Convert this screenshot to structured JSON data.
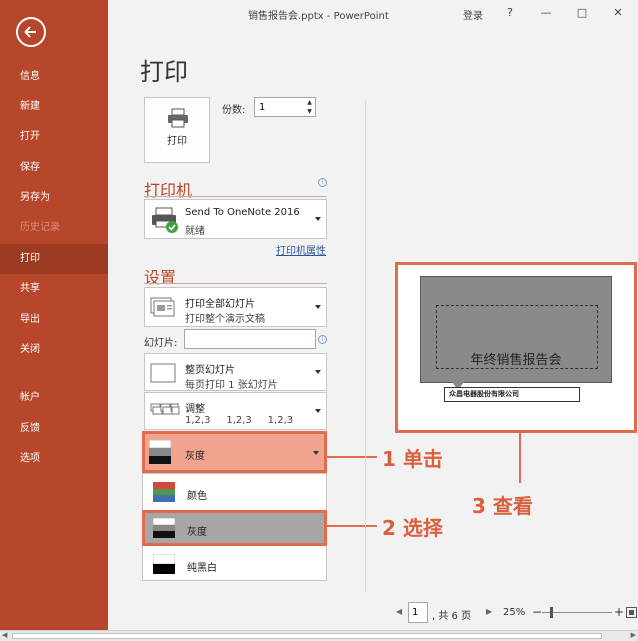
{
  "titlebar": {
    "title": "销售报告会.pptx - PowerPoint",
    "login": "登录",
    "help": "?",
    "minimize": "—",
    "maximize": "□",
    "close": "✕"
  },
  "sidebar": {
    "items": [
      {
        "label": "信息"
      },
      {
        "label": "新建"
      },
      {
        "label": "打开"
      },
      {
        "label": "保存"
      },
      {
        "label": "另存为"
      },
      {
        "label": "历史记录"
      },
      {
        "label": "打印"
      },
      {
        "label": "共享"
      },
      {
        "label": "导出"
      },
      {
        "label": "关闭"
      },
      {
        "label": "帐户"
      },
      {
        "label": "反馈"
      },
      {
        "label": "选项"
      }
    ]
  },
  "print": {
    "heading": "打印",
    "button_label": "打印",
    "copies_label": "份数:",
    "copies_value": "1"
  },
  "printer": {
    "section_title": "打印机",
    "name": "Send To OneNote 2016",
    "status": "就绪",
    "properties_link": "打印机属性"
  },
  "settings": {
    "section_title": "设置",
    "range": {
      "main": "打印全部幻灯片",
      "sub": "打印整个演示文稿"
    },
    "slides_label": "幻灯片:",
    "slides_value": "",
    "layout": {
      "main": "整页幻灯片",
      "sub": "每页打印 1 张幻灯片"
    },
    "collate": {
      "main": "调整",
      "sub": "1,2,3     1,2,3     1,2,3"
    },
    "color": {
      "main": "灰度"
    },
    "color_options": [
      {
        "label": "颜色"
      },
      {
        "label": "灰度"
      },
      {
        "label": "纯黑白"
      }
    ]
  },
  "callouts": {
    "step1": "1 单击",
    "step2": "2 选择",
    "step3": "3 查看"
  },
  "preview": {
    "slide_title": "年终销售报告会",
    "company": "众昌电器股份有限公司"
  },
  "footer": {
    "prev": "◀",
    "page_value": "1",
    "total": ", 共 6 页",
    "next": "▶",
    "zoom": "25%",
    "zoom_minus": "−",
    "zoom_plus": "+"
  }
}
